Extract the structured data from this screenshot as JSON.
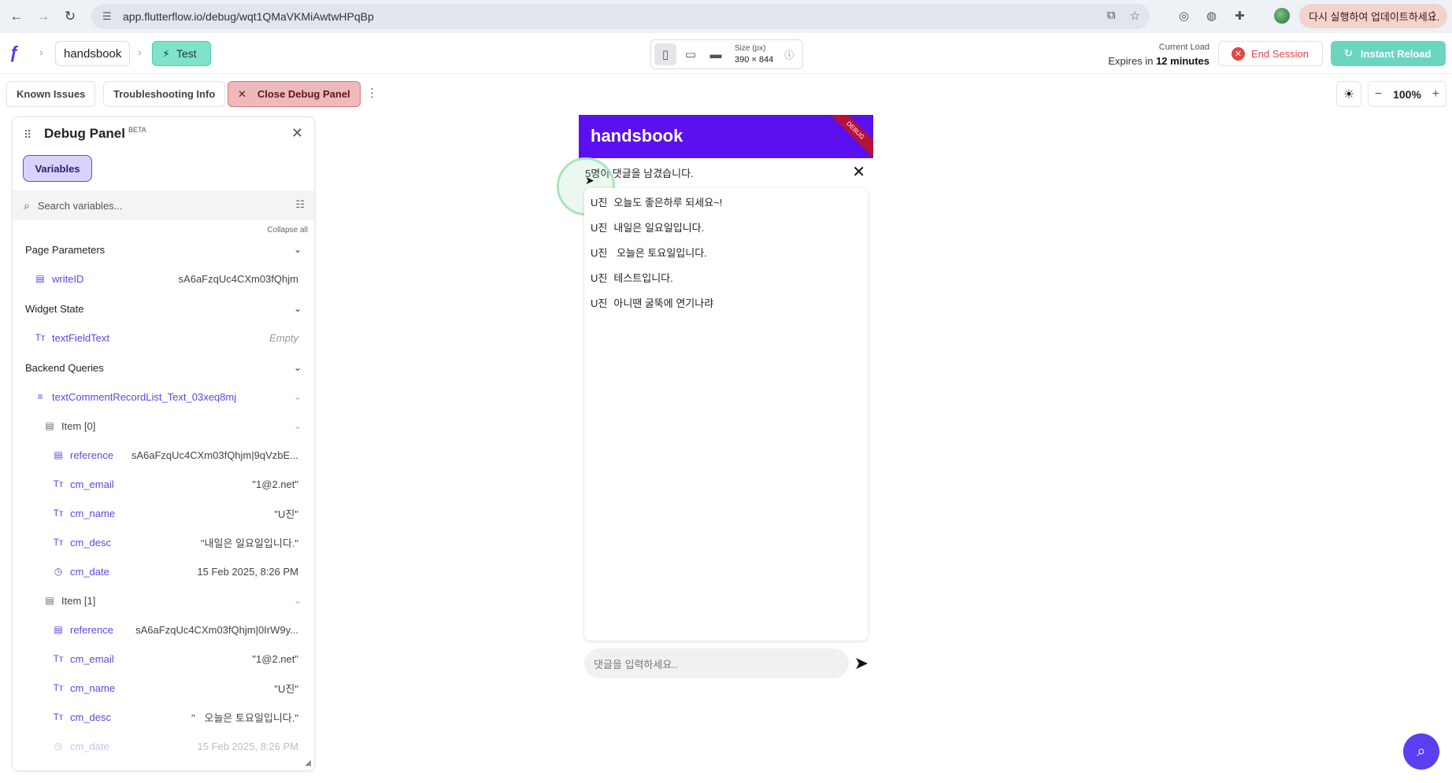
{
  "browser": {
    "url": "app.flutterflow.io/debug/wqt1QMaVKMiAwtwHPqBp",
    "update_label": "다시 실행하여 업데이트하세요."
  },
  "header": {
    "project": "handsbook",
    "mode": "Test",
    "size_label": "Size (px)",
    "size_value": "390 × 844",
    "load_label": "Current Load",
    "expires_prefix": "Expires in ",
    "expires_value": "12 minutes",
    "end_session": "End Session",
    "instant_reload": "Instant Reload"
  },
  "toolbar": {
    "known_issues": "Known Issues",
    "troubleshooting": "Troubleshooting Info",
    "close_debug": "Close Debug Panel",
    "zoom": "100%"
  },
  "debug_panel": {
    "title": "Debug Panel",
    "badge": "BETA",
    "tab": "Variables",
    "search_placeholder": "Search variables...",
    "collapse_all": "Collapse all",
    "sections": {
      "page_params": "Page Parameters",
      "widget_state": "Widget State",
      "backend": "Backend Queries"
    },
    "writeID": {
      "name": "writeID",
      "value": "sA6aFzqUc4CXm03fQhjm"
    },
    "textFieldText": {
      "name": "textFieldText",
      "value": "Empty"
    },
    "query_name": "textCommentRecordList_Text_03xeq8mj",
    "items": [
      {
        "label": "Item [0]",
        "reference": "sA6aFzqUc4CXm03fQhjm|9qVzbE...",
        "cm_email": "\"1@2.net\"",
        "cm_name": "\"U진\"",
        "cm_desc": "\"내일은 일요일입니다.\"",
        "cm_date": "15 Feb 2025, 8:26 PM"
      },
      {
        "label": "Item [1]",
        "reference": "sA6aFzqUc4CXm03fQhjm|0IrW9y...",
        "cm_email": "\"1@2.net\"",
        "cm_name": "\"U진\"",
        "cm_desc": "\"ㅤ오늘은 토요일입니다.\"",
        "cm_date": "15 Feb 2025, 8:26 PM"
      }
    ],
    "field_names": {
      "reference": "reference",
      "cm_email": "cm_email",
      "cm_name": "cm_name",
      "cm_desc": "cm_desc",
      "cm_date": "cm_date"
    }
  },
  "app": {
    "title": "handsbook",
    "ribbon": "DEBUG",
    "count_text": "5명이 댓글을 남겼습니다.",
    "comments": [
      {
        "name": "U진",
        "text": "오늘도 좋은하루 되세요~!"
      },
      {
        "name": "U진",
        "text": "내일은 일요일입니다."
      },
      {
        "name": "U진",
        "text": " 오늘은 토요일입니다."
      },
      {
        "name": "U진",
        "text": "테스트입니다."
      },
      {
        "name": "U진",
        "text": "아니땐 굴뚝에 연기나랴"
      }
    ],
    "input_placeholder": "댓글을 입력하세요.."
  }
}
